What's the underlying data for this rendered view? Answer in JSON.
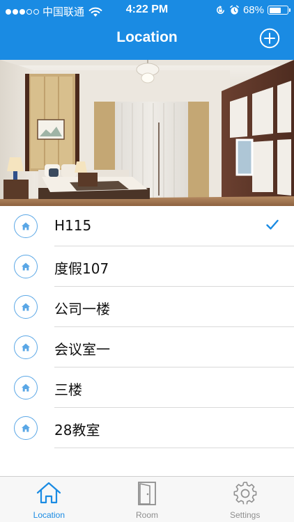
{
  "status_bar": {
    "carrier": "中国联通",
    "time": "4:22 PM",
    "battery": "68%",
    "battery_level": 0.68,
    "signal_bars_filled": 3,
    "signal_bars_total": 5
  },
  "nav": {
    "title": "Location",
    "add_icon": "plus-circle-icon"
  },
  "locations": [
    {
      "label": "H115",
      "selected": true
    },
    {
      "label": "度假107",
      "selected": false
    },
    {
      "label": "公司一楼",
      "selected": false
    },
    {
      "label": "会议室一",
      "selected": false
    },
    {
      "label": "三楼",
      "selected": false
    },
    {
      "label": "28教室",
      "selected": false
    }
  ],
  "tabs": [
    {
      "label": "Location",
      "icon": "home-icon",
      "active": true
    },
    {
      "label": "Room",
      "icon": "door-icon",
      "active": false
    },
    {
      "label": "Settings",
      "icon": "gear-icon",
      "active": false
    }
  ],
  "colors": {
    "accent": "#1a8be3",
    "badge_border": "#5aa7e6",
    "inactive": "#8e8e8e"
  }
}
